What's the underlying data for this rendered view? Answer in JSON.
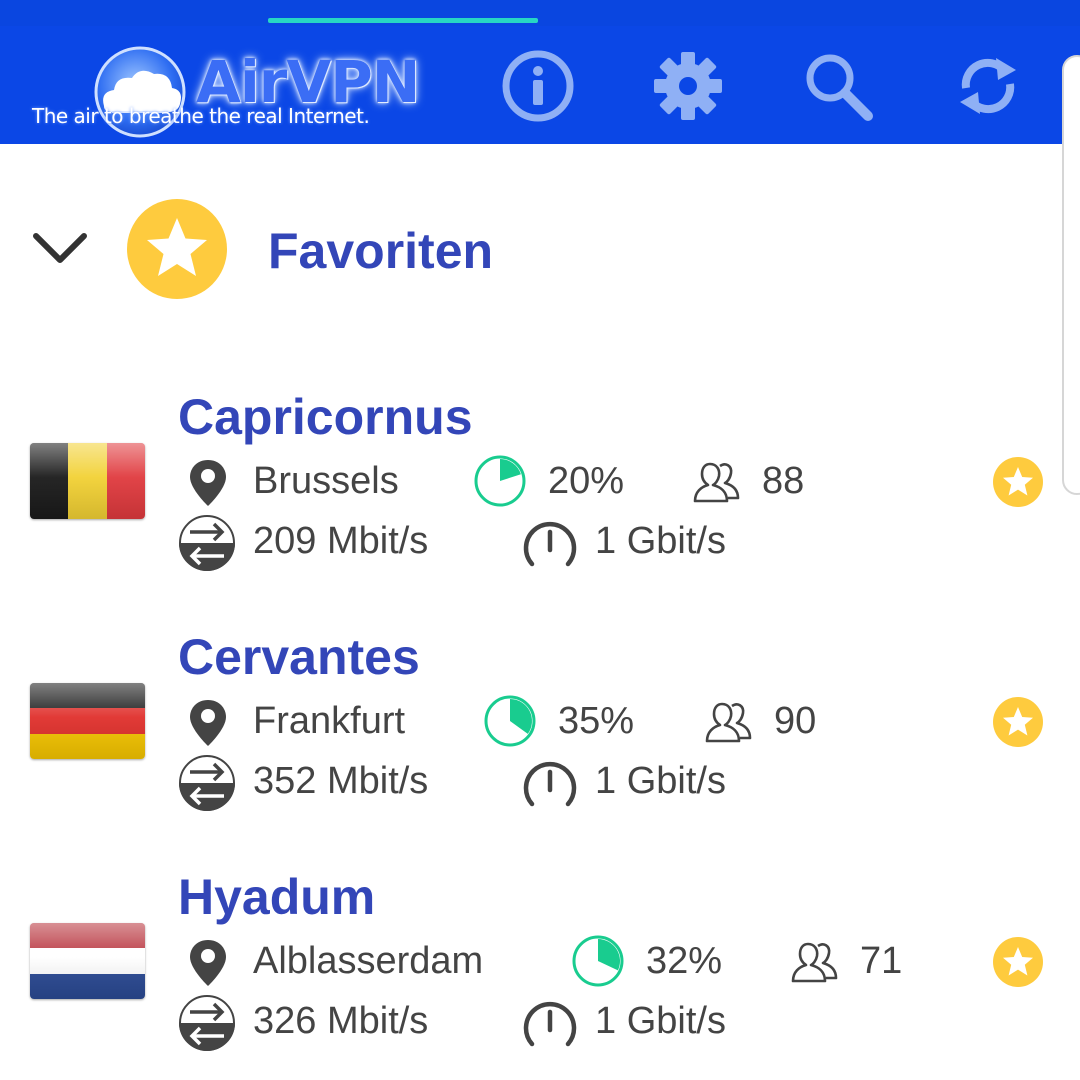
{
  "header": {
    "logo_title": "AirVPN",
    "logo_tagline": "The air to breathe the real Internet.",
    "icons": [
      "info-icon",
      "settings-gear-icon",
      "search-icon",
      "refresh-icon"
    ],
    "accent_color": "#0b47e6",
    "tab_indicator_color": "#27d7c4"
  },
  "group": {
    "title": "Favoriten",
    "icon": "star-icon",
    "star_color": "#fecb3e"
  },
  "servers": [
    {
      "name": "Capricornus",
      "country": "Belgium",
      "location": "Brussels",
      "load": "20%",
      "load_value": 0.2,
      "users": "88",
      "bandwidth": "209 Mbit/s",
      "max_speed": "1 Gbit/s",
      "flag_colors": [
        "#1a1a1a",
        "#f2d134",
        "#e03a3e"
      ]
    },
    {
      "name": "Cervantes",
      "country": "Germany",
      "location": "Frankfurt",
      "load": "35%",
      "load_value": 0.35,
      "users": "90",
      "bandwidth": "352 Mbit/s",
      "max_speed": "1 Gbit/s",
      "flag_colors": [
        "#1a1a1a",
        "#e0302c",
        "#f5c500"
      ]
    },
    {
      "name": "Hyadum",
      "country": "Netherlands",
      "location": "Alblasserdam",
      "load": "32%",
      "load_value": 0.32,
      "users": "71",
      "bandwidth": "326 Mbit/s",
      "max_speed": "1 Gbit/s",
      "flag_colors": [
        "#b8343d",
        "#ffffff",
        "#2b4a94"
      ]
    }
  ],
  "load_color": "#19cc8f"
}
